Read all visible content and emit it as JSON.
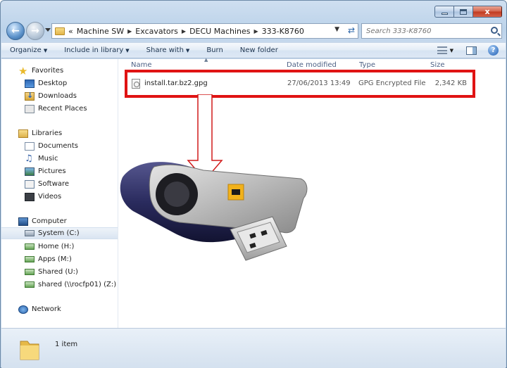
{
  "window": {
    "caption": {
      "minimize": "",
      "maximize": "",
      "close": "x"
    }
  },
  "nav": {
    "back_icon": "back-arrow-icon",
    "forward_icon": "forward-arrow-icon",
    "breadcrumb": [
      {
        "label": "«"
      },
      {
        "label": "Machine SW"
      },
      {
        "label": "Excavators"
      },
      {
        "label": "DECU Machines"
      },
      {
        "label": "333-K8760"
      }
    ],
    "search_placeholder": "Search 333-K8760"
  },
  "toolbar": {
    "organize": "Organize",
    "include_in_library": "Include in library",
    "share_with": "Share with",
    "burn": "Burn",
    "new_folder": "New folder",
    "help": "?"
  },
  "sidebar": {
    "favorites_header": "Favorites",
    "favorites": [
      "Desktop",
      "Downloads",
      "Recent Places"
    ],
    "libraries_header": "Libraries",
    "libraries": [
      "Documents",
      "Music",
      "Pictures",
      "Software",
      "Videos"
    ],
    "computer_header": "Computer",
    "drives": [
      "System (C:)",
      "Home (H:)",
      "Apps (M:)",
      "Shared (U:)",
      "shared (\\\\rocfp01) (Z:)"
    ],
    "network_header": "Network"
  },
  "columns": {
    "name": "Name",
    "date_modified": "Date modified",
    "type": "Type",
    "size": "Size"
  },
  "files": [
    {
      "name": "install.tar.bz2.gpg",
      "date_modified": "27/06/2013 13:49",
      "type": "GPG Encrypted File",
      "size": "2,342 KB"
    }
  ],
  "status": {
    "item_count": "1 item"
  },
  "colors": {
    "highlight": "#e01313",
    "window_frame": "#bcd3ea",
    "close_button": "#c0391f"
  }
}
